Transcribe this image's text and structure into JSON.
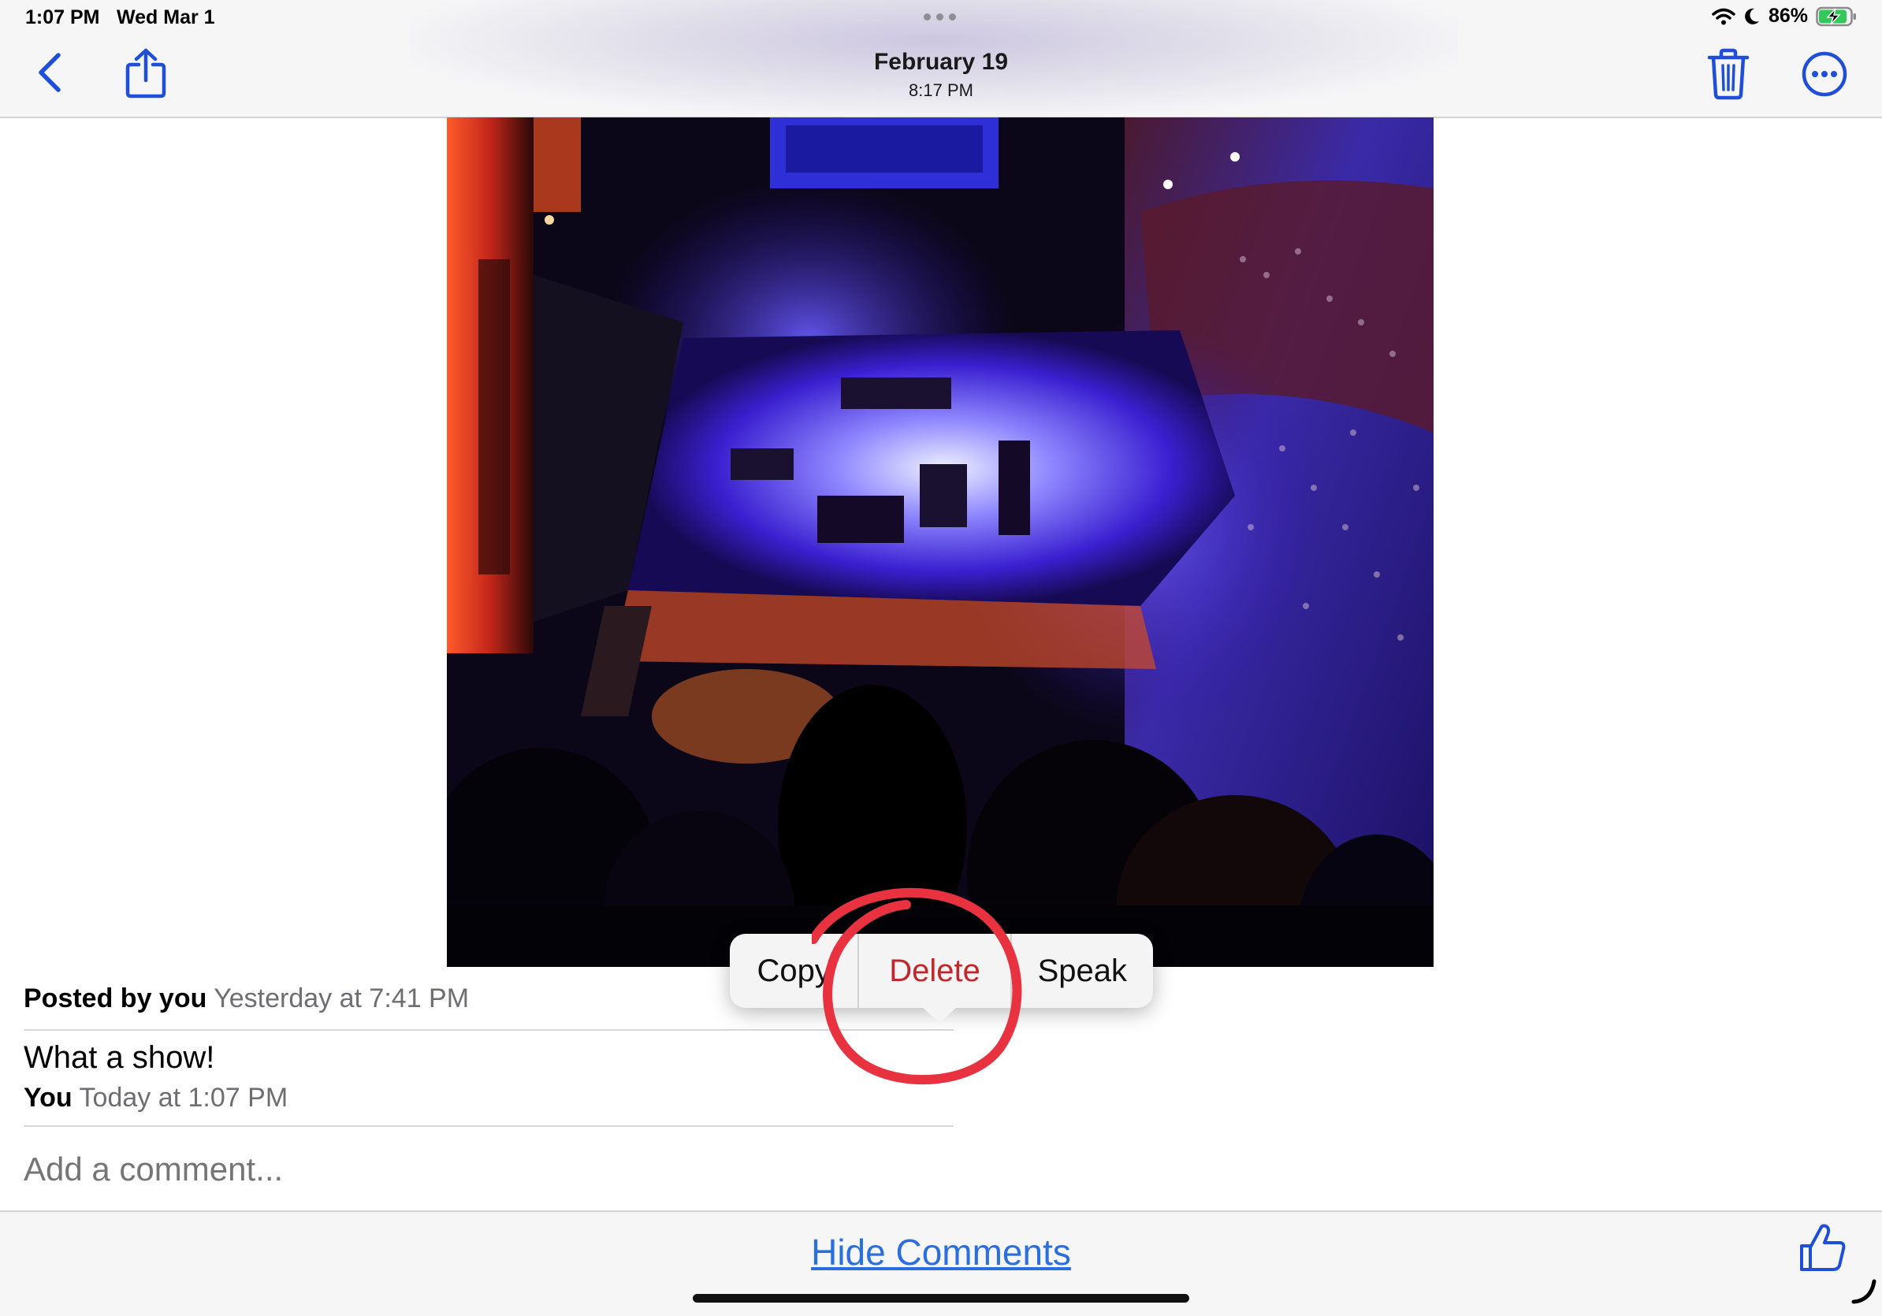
{
  "status_bar": {
    "time": "1:07 PM",
    "date": "Wed Mar 1",
    "battery_percent": "86%",
    "icons": [
      "wifi-icon",
      "moon-icon",
      "battery-charging-icon"
    ]
  },
  "nav": {
    "title": "February 19",
    "subtitle": "8:17 PM",
    "left_icons": [
      "back-chevron-icon",
      "share-icon"
    ],
    "right_icons": [
      "trash-icon",
      "more-ellipsis-icon"
    ],
    "accent_color": "#1f4fd8"
  },
  "photo": {
    "subject": "concert arena stage photo"
  },
  "post": {
    "posted_by": "Posted by you",
    "posted_when": "Yesterday at 7:41 PM"
  },
  "comments": [
    {
      "text": "What a show!",
      "author": "You",
      "when": "Today at 1:07 PM"
    }
  ],
  "comment_input": {
    "placeholder": "Add a comment..."
  },
  "context_menu": {
    "items": [
      "Copy",
      "Delete",
      "Speak"
    ],
    "highlighted": "Delete",
    "delete_color": "#c2262a"
  },
  "annotation": {
    "shape": "hand-drawn circle",
    "color": "#e8323f"
  },
  "bottom_bar": {
    "hide_comments_label": "Hide Comments",
    "link_color": "#2a6fdb",
    "like_icon": "thumbs-up-icon"
  }
}
